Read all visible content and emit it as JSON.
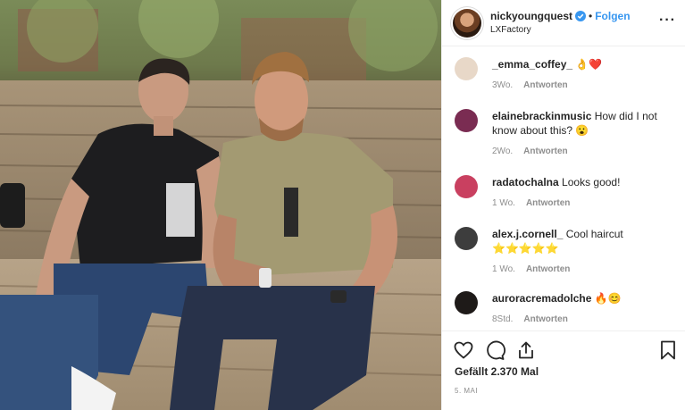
{
  "post": {
    "username": "nickyoungquest",
    "follow_label": "Folgen",
    "location": "LXFactory",
    "more_label": "···"
  },
  "comments": [
    {
      "user": "_emma_coffey_",
      "text": "👌❤️",
      "time": "3Wo.",
      "reply": "Antworten",
      "avatar_color": "#e8d8c8"
    },
    {
      "user": "elainebrackinmusic",
      "text": "How did I not know about this? 😮",
      "time": "2Wo.",
      "reply": "Antworten",
      "avatar_color": "#7a2c52"
    },
    {
      "user": "radatochalna",
      "text": "Looks good!",
      "time": "1 Wo.",
      "reply": "Antworten",
      "avatar_color": "#c94060"
    },
    {
      "user": "alex.j.cornell_",
      "text": "Cool haircut ⭐⭐⭐⭐⭐",
      "time": "1 Wo.",
      "reply": "Antworten",
      "avatar_color": "#3d3d3d"
    },
    {
      "user": "auroracremadolche",
      "text": "🔥😊",
      "time": "8Std.",
      "reply": "Antworten",
      "avatar_color": "#1e1a18"
    }
  ],
  "footer": {
    "likes": "Gefällt 2.370 Mal",
    "date": "5. MAI"
  },
  "icons": [
    "heart-icon",
    "comment-icon",
    "share-icon",
    "bookmark-icon",
    "verified-icon",
    "more-icon"
  ],
  "colors": {
    "link": "#3897f0",
    "muted": "#8e8e8e",
    "text": "#262626"
  }
}
